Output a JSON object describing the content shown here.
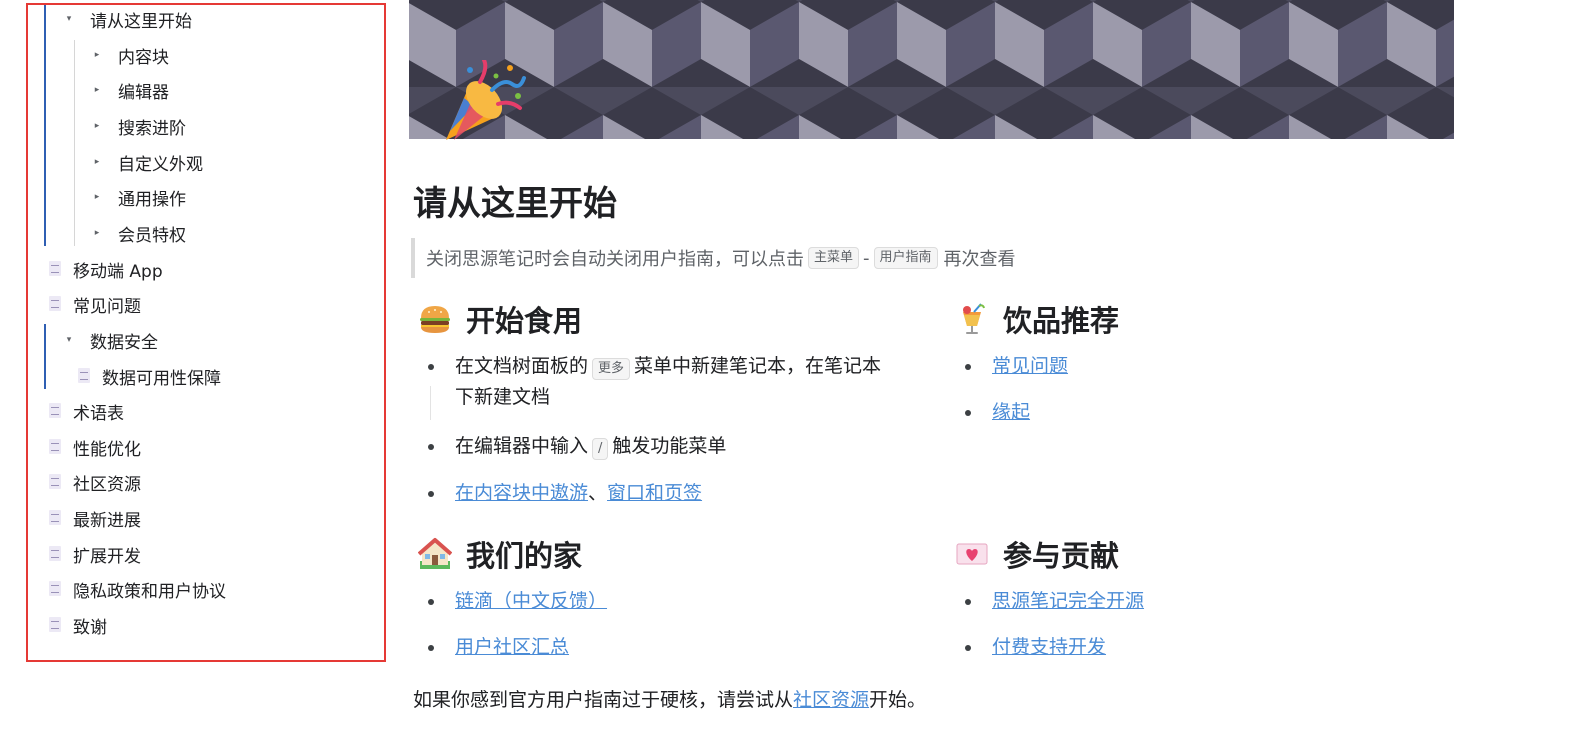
{
  "sidebar": {
    "items": [
      {
        "label": "请从这里开始",
        "kind": "toggle-open",
        "level": 0
      },
      {
        "label": "内容块",
        "kind": "toggle-closed",
        "level": 1
      },
      {
        "label": "编辑器",
        "kind": "toggle-closed",
        "level": 1
      },
      {
        "label": "搜索进阶",
        "kind": "toggle-closed",
        "level": 1
      },
      {
        "label": "自定义外观",
        "kind": "toggle-closed",
        "level": 1
      },
      {
        "label": "通用操作",
        "kind": "toggle-closed",
        "level": 1
      },
      {
        "label": "会员特权",
        "kind": "toggle-closed",
        "level": 1
      },
      {
        "label": "移动端 App",
        "kind": "doc",
        "level": 0
      },
      {
        "label": "常见问题",
        "kind": "doc",
        "level": 0
      },
      {
        "label": "数据安全",
        "kind": "toggle-open",
        "level": 0
      },
      {
        "label": "数据可用性保障",
        "kind": "doc",
        "level": 1
      },
      {
        "label": "术语表",
        "kind": "doc",
        "level": 0
      },
      {
        "label": "性能优化",
        "kind": "doc",
        "level": 0
      },
      {
        "label": "社区资源",
        "kind": "doc",
        "level": 0
      },
      {
        "label": "最新进展",
        "kind": "doc",
        "level": 0
      },
      {
        "label": "扩展开发",
        "kind": "doc",
        "level": 0
      },
      {
        "label": "隐私政策和用户协议",
        "kind": "doc",
        "level": 0
      },
      {
        "label": "致谢",
        "kind": "doc",
        "level": 0
      }
    ],
    "toggle_open_glyph": "▾",
    "toggle_closed_glyph": "▸"
  },
  "doc": {
    "icon": "party-popper-icon",
    "title": "请从这里开始",
    "quote": {
      "text_before": "关闭思源笔记时会自动关闭用户指南，可以点击",
      "kbd1": "主菜单",
      "sep": "-",
      "kbd2": "用户指南",
      "text_after": "再次查看"
    },
    "sections": {
      "start": {
        "heading": "开始食用",
        "icon": "hamburger-icon",
        "item1_a": "在文档树面板的",
        "item1_kbd": "更多",
        "item1_b": "菜单中新建笔记本，在笔记本",
        "item1_c": "下新建文档",
        "item2_a": "在编辑器中输入",
        "item2_kbd": "/",
        "item2_b": "触发功能菜单",
        "item3_link1": "在内容块中遨游",
        "item3_sep": "、",
        "item3_link2": "窗口和页签"
      },
      "drinks": {
        "heading": "饮品推荐",
        "icon": "cocktail-icon",
        "link1": "常见问题",
        "link2": "缘起"
      },
      "home": {
        "heading": "我们的家",
        "icon": "house-icon",
        "link1": "链滴（中文反馈）",
        "link2": "用户社区汇总"
      },
      "contrib": {
        "heading": "参与贡献",
        "icon": "love-letter-icon",
        "link1": "思源笔记完全开源",
        "link2": "付费支持开发"
      }
    },
    "footer": {
      "before": "如果你感到官方用户指南过于硬核，请尝试从",
      "link": "社区资源",
      "after": "开始。"
    }
  },
  "colors": {
    "link": "#4a8bd6",
    "highlight_border": "#e53935",
    "tree_guide": "#2f5fb3"
  }
}
